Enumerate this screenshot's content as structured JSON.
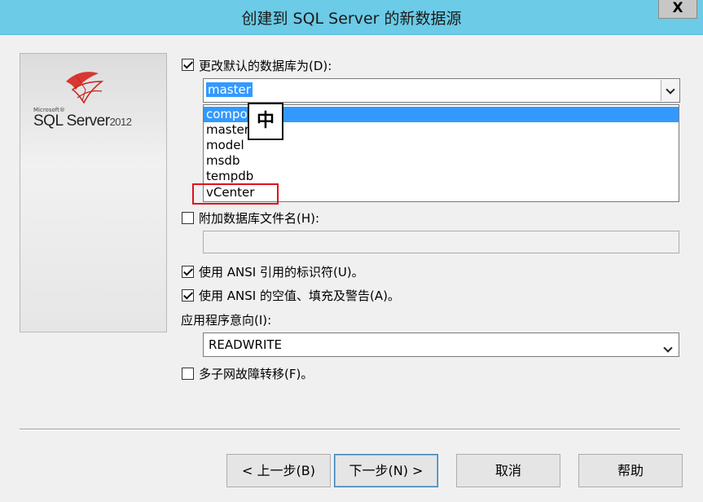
{
  "window": {
    "title": "创建到 SQL Server 的新数据源",
    "close_label": "X"
  },
  "logo": {
    "small_text": "Microsoft®",
    "product": "SQL Server",
    "version": "2012"
  },
  "change_db": {
    "label": "更改默认的数据库为(D):",
    "checked": true,
    "value": "master"
  },
  "db_options": [
    "compo",
    "master",
    "model",
    "msdb",
    "tempdb",
    "vCenter"
  ],
  "ime_indicator": "中",
  "attach_file": {
    "label": "附加数据库文件名(H):",
    "checked": false,
    "value": ""
  },
  "ansi_quoted": {
    "label": "使用 ANSI 引用的标识符(U)。",
    "checked": true
  },
  "ansi_nulls": {
    "label": "使用 ANSI 的空值、填充及警告(A)。",
    "checked": true
  },
  "app_intent": {
    "label": "应用程序意向(I):",
    "value": "READWRITE"
  },
  "multi_subnet": {
    "label": "多子网故障转移(F)。",
    "checked": false
  },
  "buttons": {
    "back": "< 上一步(B)",
    "next": "下一步(N) >",
    "cancel": "取消",
    "help": "帮助"
  },
  "colors": {
    "titlebar": "#6ccbe7",
    "selection": "#3399ff",
    "highlight_box": "#e0101a"
  }
}
